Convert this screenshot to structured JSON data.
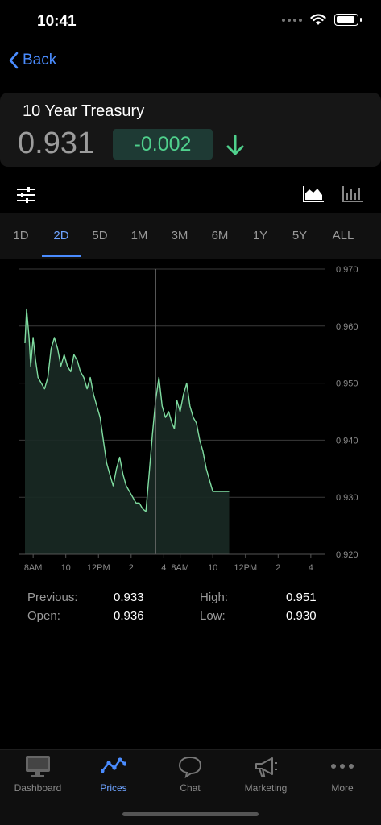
{
  "status_bar": {
    "time": "10:41"
  },
  "nav": {
    "back_label": "Back"
  },
  "quote": {
    "title": "10 Year Treasury",
    "price": "0.931",
    "change": "-0.002",
    "direction": "down",
    "change_color": "#4fd08c"
  },
  "toolbar": {
    "filter_icon": "sliders-icon",
    "area_chart_icon": "area-chart-icon",
    "bar_chart_icon": "bar-chart-icon"
  },
  "range_tabs": [
    {
      "label": "1D",
      "active": false
    },
    {
      "label": "2D",
      "active": true
    },
    {
      "label": "5D",
      "active": false
    },
    {
      "label": "1M",
      "active": false
    },
    {
      "label": "3M",
      "active": false
    },
    {
      "label": "6M",
      "active": false
    },
    {
      "label": "1Y",
      "active": false
    },
    {
      "label": "5Y",
      "active": false
    },
    {
      "label": "ALL",
      "active": false
    }
  ],
  "chart_data": {
    "type": "area",
    "color": "#7fdca0",
    "ylim": [
      0.92,
      0.97
    ],
    "yticks": [
      "0.970",
      "0.960",
      "0.950",
      "0.940",
      "0.930",
      "0.920"
    ],
    "xtick_labels": [
      "8AM",
      "10",
      "12PM",
      "2",
      "4",
      "8AM",
      "10",
      "12PM",
      "2",
      "4"
    ],
    "xlim": [
      0,
      18
    ],
    "x_hours": [
      0,
      0.1,
      0.25,
      0.35,
      0.5,
      0.65,
      0.8,
      1.0,
      1.2,
      1.4,
      1.6,
      1.8,
      2.0,
      2.2,
      2.4,
      2.6,
      2.8,
      3.0,
      3.2,
      3.4,
      3.6,
      3.8,
      4.0,
      4.2,
      4.4,
      4.6,
      4.8,
      5.0,
      5.2,
      5.4,
      5.6,
      5.8,
      6.0,
      6.2,
      6.4,
      6.6,
      6.8,
      7.0,
      7.2,
      7.4,
      7.6,
      7.8,
      8.0,
      8.2,
      8.4,
      8.6,
      8.8,
      9.0,
      9.15,
      9.3,
      9.5,
      9.7,
      9.9,
      10.1,
      10.3,
      10.5,
      10.7,
      10.9,
      11.1,
      11.3,
      11.5,
      11.7,
      11.9,
      12.1,
      12.3,
      12.5
    ],
    "values": [
      0.957,
      0.963,
      0.958,
      0.953,
      0.958,
      0.954,
      0.951,
      0.95,
      0.949,
      0.951,
      0.956,
      0.958,
      0.956,
      0.953,
      0.955,
      0.953,
      0.952,
      0.955,
      0.954,
      0.952,
      0.951,
      0.949,
      0.951,
      0.948,
      0.946,
      0.944,
      0.94,
      0.936,
      0.934,
      0.932,
      0.935,
      0.937,
      0.934,
      0.932,
      0.931,
      0.93,
      0.929,
      0.929,
      0.928,
      0.9275,
      0.934,
      0.941,
      0.947,
      0.951,
      0.946,
      0.944,
      0.945,
      0.943,
      0.942,
      0.947,
      0.945,
      0.948,
      0.95,
      0.946,
      0.944,
      0.943,
      0.94,
      0.938,
      0.935,
      0.933,
      0.931,
      0.931,
      0.931,
      0.931,
      0.931,
      0.931
    ],
    "cursor_x_hour": 8.0
  },
  "stats": {
    "previous_label": "Previous:",
    "previous_value": "0.933",
    "open_label": "Open:",
    "open_value": "0.936",
    "high_label": "High:",
    "high_value": "0.951",
    "low_label": "Low:",
    "low_value": "0.930"
  },
  "tabs": [
    {
      "label": "Dashboard",
      "icon": "monitor-icon",
      "active": false
    },
    {
      "label": "Prices",
      "icon": "trend-line-icon",
      "active": true
    },
    {
      "label": "Chat",
      "icon": "chat-bubbles-icon",
      "active": false
    },
    {
      "label": "Marketing",
      "icon": "megaphone-icon",
      "active": false
    },
    {
      "label": "More",
      "icon": "more-dots-icon",
      "active": false
    }
  ]
}
